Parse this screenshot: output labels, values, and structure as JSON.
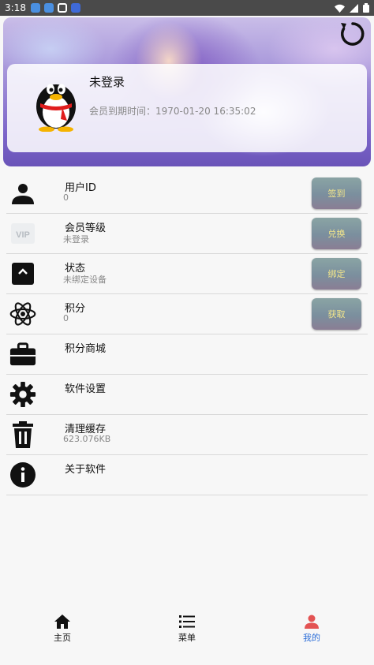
{
  "status_bar": {
    "time": "3:18",
    "notification_icons": [
      "download-icon",
      "download-icon",
      "screenshot-icon",
      "app-icon"
    ],
    "system_icons": [
      "wifi-icon",
      "signal-icon",
      "battery-icon"
    ]
  },
  "header": {
    "refresh_icon": "refresh-icon",
    "username": "未登录",
    "expire_text": "会员到期时间：1970-01-20 16:35:02"
  },
  "menu": {
    "items": [
      {
        "icon": "user-icon",
        "title": "用户ID",
        "subtitle": "0",
        "button": "签到"
      },
      {
        "icon": "vip-icon",
        "title": "会员等级",
        "subtitle": "未登录",
        "button": "兑换"
      },
      {
        "icon": "status-icon",
        "title": "状态",
        "subtitle": "未绑定设备",
        "button": "绑定"
      },
      {
        "icon": "atom-icon",
        "title": "积分",
        "subtitle": "0",
        "button": "获取"
      },
      {
        "icon": "shop-icon",
        "title": "积分商城",
        "subtitle": ""
      },
      {
        "icon": "settings-icon",
        "title": "软件设置",
        "subtitle": ""
      },
      {
        "icon": "trash-icon",
        "title": "清理缓存",
        "subtitle": "623.076KB"
      },
      {
        "icon": "info-icon",
        "title": "关于软件",
        "subtitle": ""
      }
    ]
  },
  "bottom_nav": {
    "items": [
      {
        "icon": "home-icon",
        "label": "主页"
      },
      {
        "icon": "menu-list-icon",
        "label": "菜单"
      },
      {
        "icon": "profile-icon",
        "label": "我的"
      }
    ],
    "active_color": "#2e6fd8",
    "active_index": 2
  }
}
